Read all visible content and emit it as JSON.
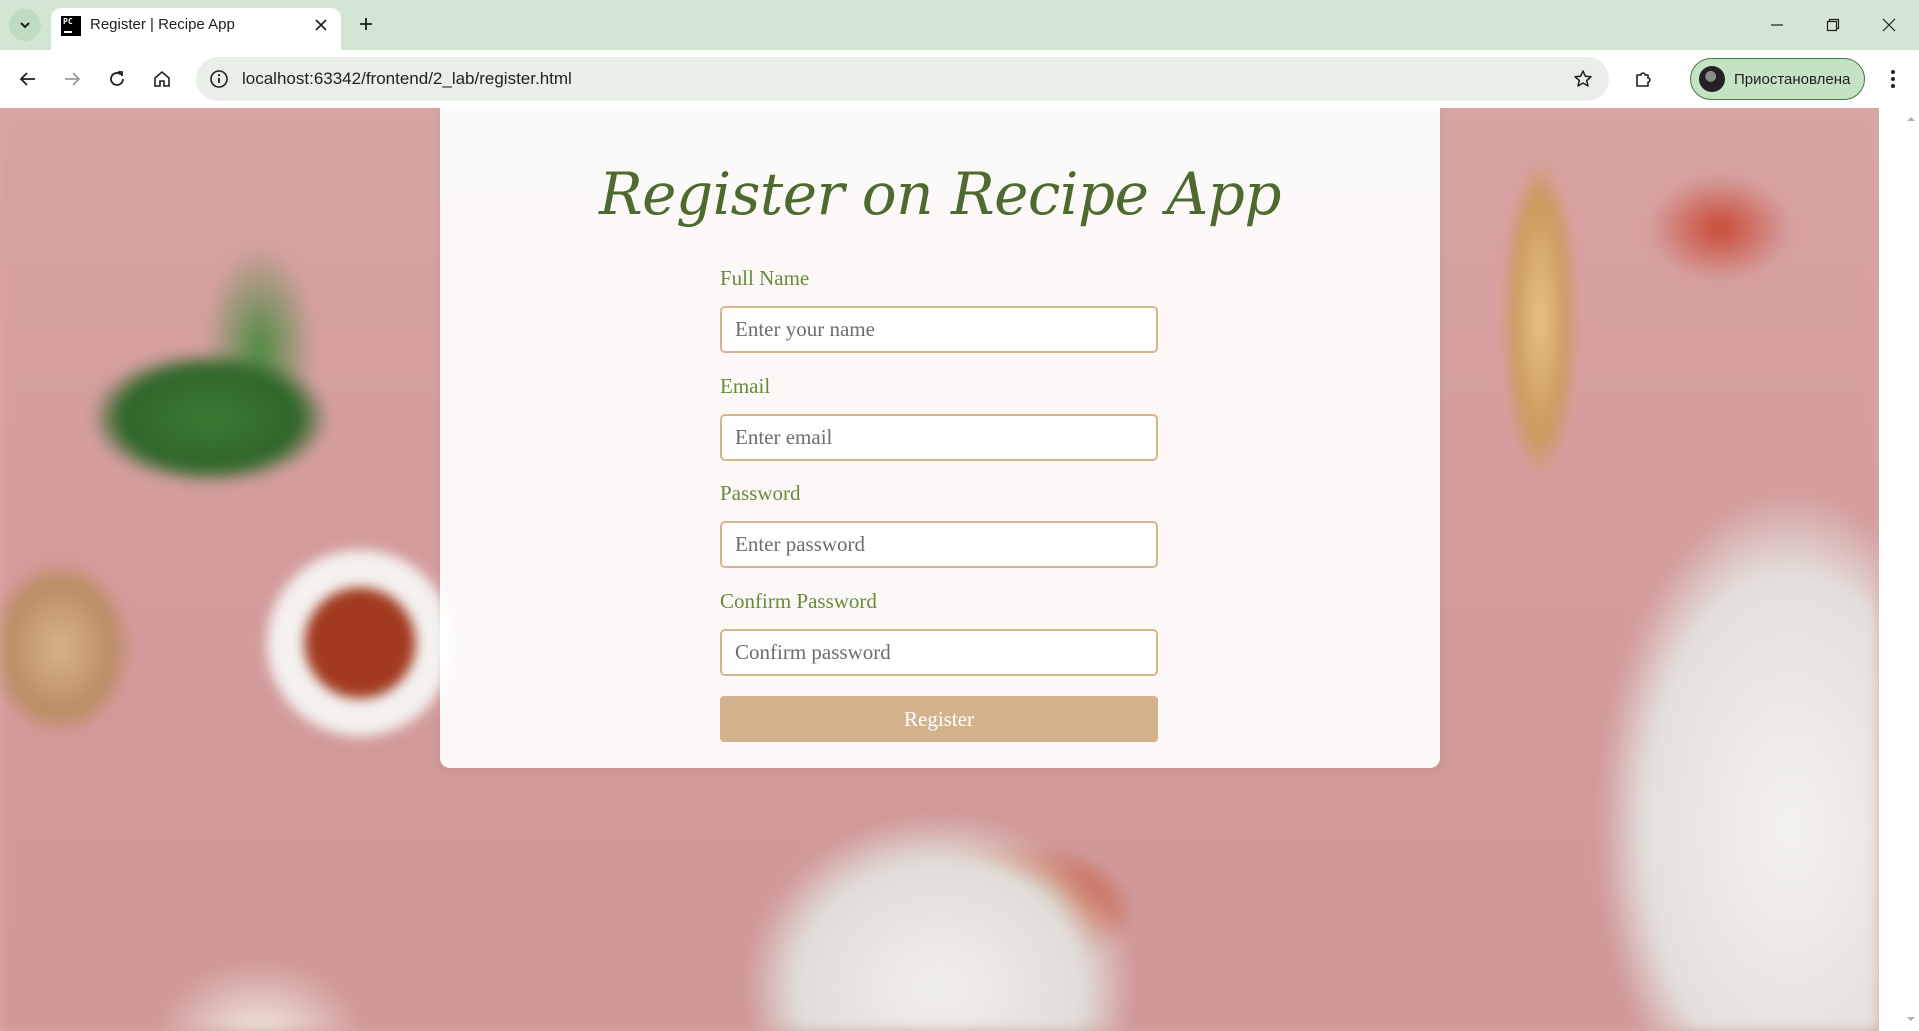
{
  "browser": {
    "tab": {
      "title": "Register | Recipe App",
      "favicon_text": "PC"
    },
    "url": "localhost:63342/frontend/2_lab/register.html",
    "profile_label": "Приостановлена",
    "icons": {
      "tab_search": "chevron-down-icon",
      "close_tab": "close-icon",
      "new_tab": "plus-icon",
      "back": "arrow-left-icon",
      "forward": "arrow-right-icon",
      "reload": "reload-icon",
      "home": "home-icon",
      "site_info": "info-icon",
      "bookmark": "star-icon",
      "extensions": "puzzle-icon",
      "menu": "kebab-menu-icon"
    }
  },
  "page": {
    "title": "Register on Recipe App",
    "fields": [
      {
        "label": "Full Name",
        "placeholder": "Enter your name",
        "value": ""
      },
      {
        "label": "Email",
        "placeholder": "Enter email",
        "value": ""
      },
      {
        "label": "Password",
        "placeholder": "Enter password",
        "value": ""
      },
      {
        "label": "Confirm Password",
        "placeholder": "Confirm password",
        "value": ""
      }
    ],
    "submit_label": "Register"
  },
  "colors": {
    "title": "#4e6a2e",
    "label": "#6a8a3a",
    "input_border": "#d6b58c",
    "button": "#d2b38d",
    "page_background": "#d7a3a3"
  }
}
